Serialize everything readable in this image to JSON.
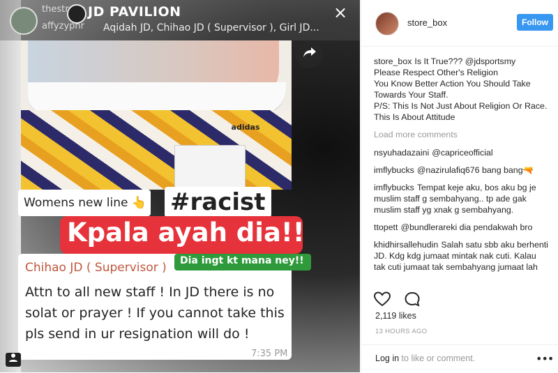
{
  "story": {
    "title": "JD PAVILION",
    "user_top": "thestraits",
    "user_bottom": "affyzyphr",
    "participants": "Aqidah JD, Chihao JD ( Supervisor ), Girl JD...",
    "close_glyph": "×",
    "share_icon": "share-arrow-icon",
    "brand_on_box": "adidas",
    "chat_first": "Womens new line 👆",
    "hashtag": "#racist",
    "red_caption": "Kpala ayah dia!!",
    "green_caption": "Dia ingt kt mana ney!!",
    "chat_sender": "Chihao JD ( Supervisor )",
    "chat_message": "Attn to all new staff ! In JD there is no solat or prayer ! If you cannot take this pls send in ur resignation will do !",
    "chat_time": "7:35 PM"
  },
  "post": {
    "author": "store_box",
    "follow_label": "Follow",
    "caption_user": "store_box",
    "caption_lines": [
      "Is It True??? @jdsportsmy",
      "Please Respect Other's Religion",
      "You Know Better Action You Should Take Towards Your Staff.",
      "P/S: This Is Not Just About Religion Or Race. This Is About Attitude"
    ],
    "load_more": "Load more comments",
    "comments": [
      {
        "user": "nsyuhadazaini",
        "text": "@capriceofficial"
      },
      {
        "user": "imflybucks",
        "text": "@nazirulafiq676 bang bang🔫"
      },
      {
        "user": "imflybucks",
        "text": "Tempat keje aku, bos aku bg je muslim staff g sembahyang.. tp ade gak muslim staff yg xnak g sembahyang."
      },
      {
        "user": "ttopett",
        "text": "@bundlerareki dia pendakwah bro"
      },
      {
        "user": "khidhirsallehudin",
        "text": "Salah satu sbb aku berhenti JD. Kdg kdg jumaat mintak nak cuti. Kalau tak cuti jumaat tak sembahyang jumaat lah"
      }
    ],
    "likes": "2,119 likes",
    "time": "13 HOURS AGO",
    "login_link": "Log in",
    "login_rest": "to like or comment.",
    "more_glyph": "•••",
    "colors": {
      "follow": "#3897f0",
      "muted": "#999999",
      "text": "#262626"
    }
  }
}
